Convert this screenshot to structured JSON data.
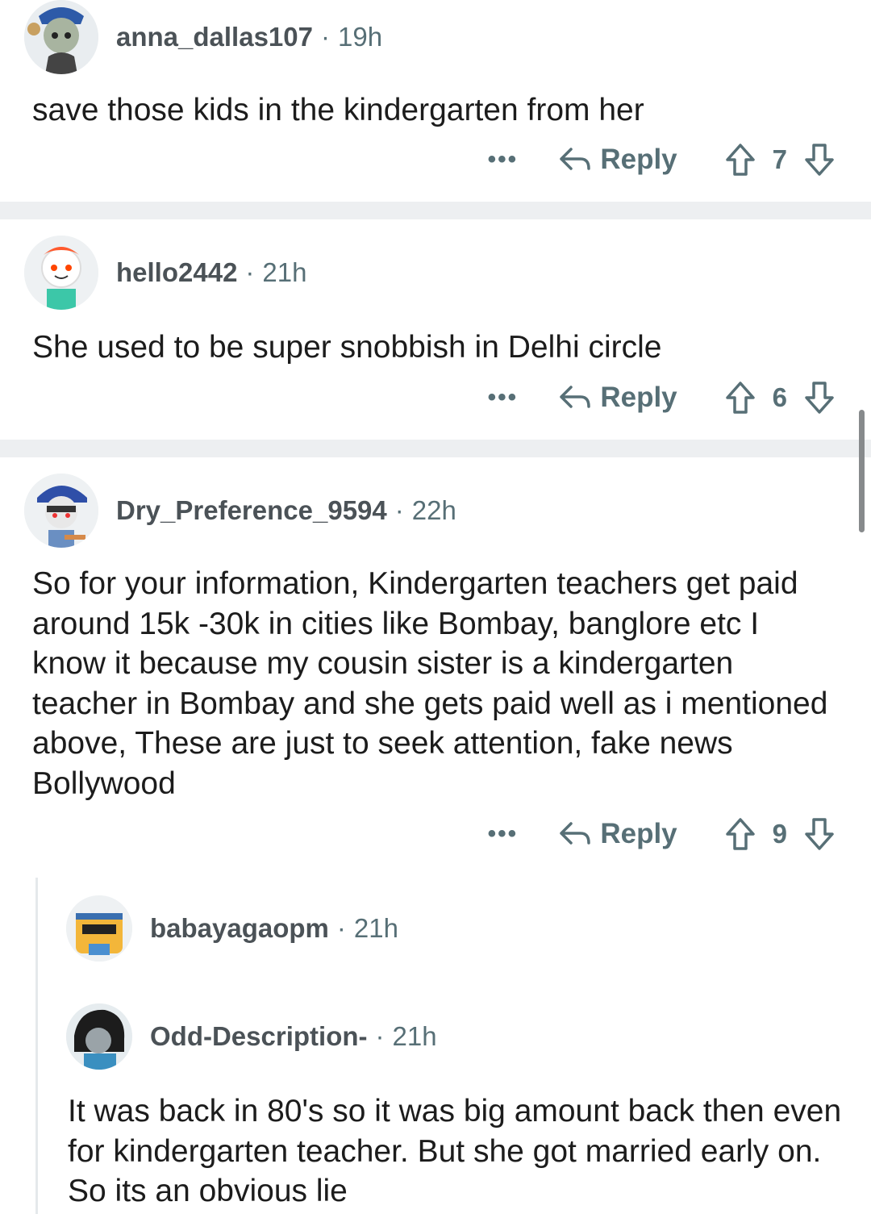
{
  "comments": [
    {
      "username": "anna_dallas107",
      "time": "19h",
      "text": "save those kids in the kindergarten from her",
      "reply_label": "Reply",
      "score": "7",
      "more": "•••"
    },
    {
      "username": "hello2442",
      "time": "21h",
      "text": "She used to be super snobbish in Delhi circle",
      "reply_label": "Reply",
      "score": "6",
      "more": "•••"
    },
    {
      "username": "Dry_Preference_9594",
      "time": "22h",
      "text": "So for your information, Kindergarten teachers get paid around 15k -30k  in cities like Bombay, banglore etc I know it because my cousin sister is a kindergarten teacher in Bombay and she gets paid well as i mentioned above, These are just to seek attention, fake news Bollywood",
      "reply_label": "Reply",
      "score": "9",
      "more": "•••"
    },
    {
      "username": "babayagaopm",
      "time": "21h"
    },
    {
      "username": "Odd-Description-",
      "time": "21h",
      "text": "It was back in 80's so it was big amount back then even for kindergarten teacher. But she got married early on. So its an obvious lie"
    }
  ],
  "separator": "·",
  "colors": {
    "meta": "#576f76",
    "divider": "#edeff1",
    "text": "#1c1c1c"
  }
}
